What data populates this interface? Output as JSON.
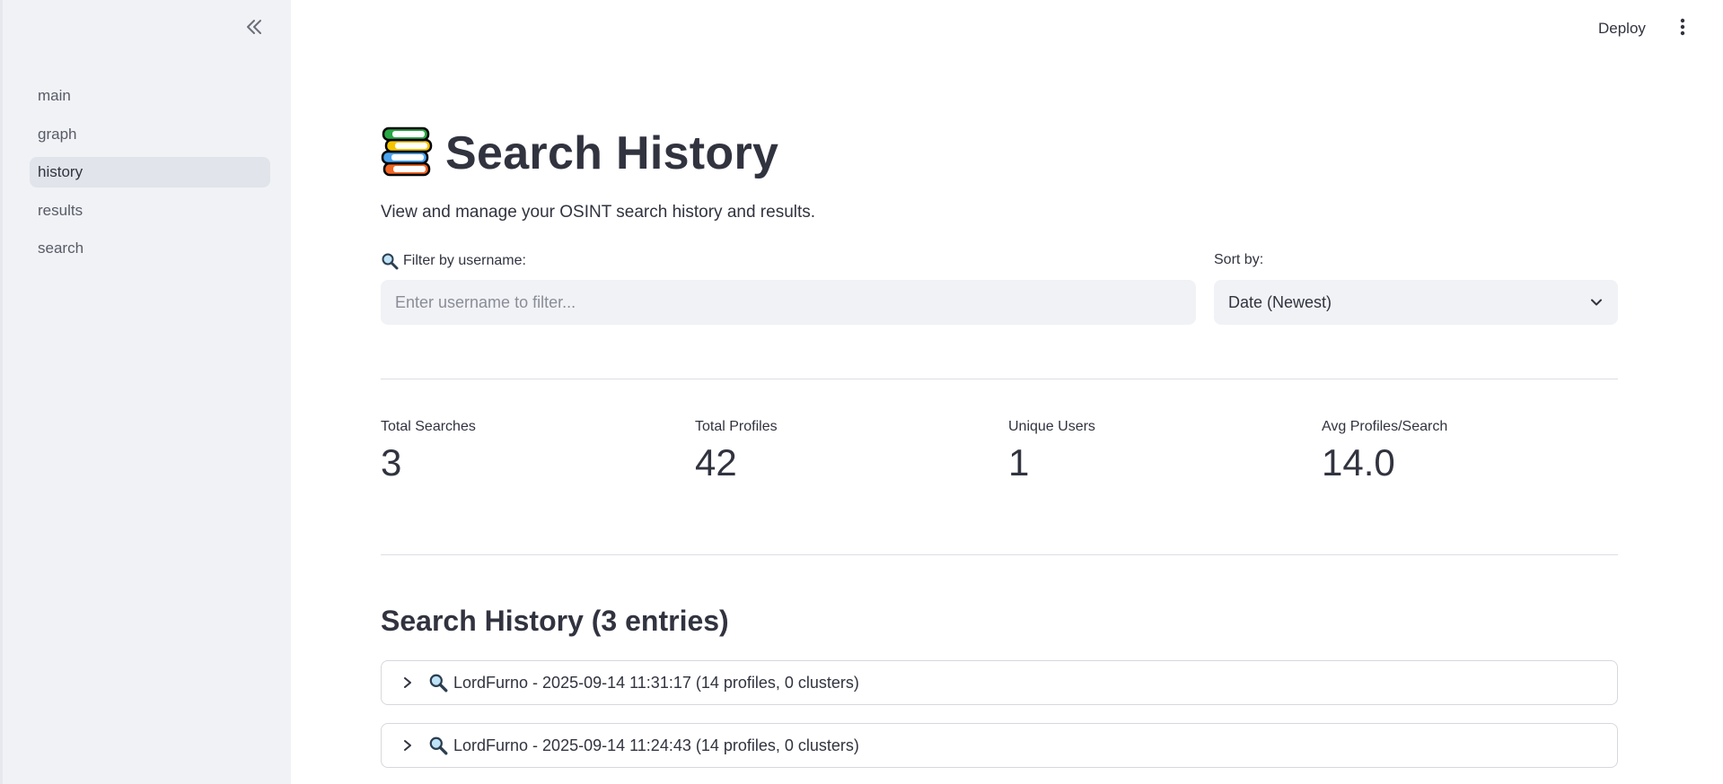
{
  "sidebar": {
    "collapse_icon": "double-chevron-left-icon",
    "items": [
      {
        "label": "main"
      },
      {
        "label": "graph"
      },
      {
        "label": "history",
        "active": true
      },
      {
        "label": "results"
      },
      {
        "label": "search"
      }
    ]
  },
  "toolbar": {
    "deploy_label": "Deploy",
    "menu_icon": "vertical-dots-icon"
  },
  "page": {
    "title_icon": "books-icon",
    "title": "Search History",
    "subtitle": "View and manage your OSINT search history and results."
  },
  "filter": {
    "icon": "magnifier-icon",
    "label": "Filter by username:",
    "placeholder": "Enter username to filter...",
    "value": ""
  },
  "sort": {
    "label": "Sort by:",
    "selected": "Date (Newest)"
  },
  "metrics": [
    {
      "label": "Total Searches",
      "value": "3"
    },
    {
      "label": "Total Profiles",
      "value": "42"
    },
    {
      "label": "Unique Users",
      "value": "1"
    },
    {
      "label": "Avg Profiles/Search",
      "value": "14.0"
    }
  ],
  "history": {
    "heading": "Search History (3 entries)",
    "entries": [
      {
        "text": "LordFurno - 2025-09-14 11:31:17 (14 profiles, 0 clusters)"
      },
      {
        "text": "LordFurno - 2025-09-14 11:24:43 (14 profiles, 0 clusters)"
      }
    ]
  },
  "colors": {
    "sidebar_bg": "#f0f2f6",
    "active_nav_bg": "#e1e4ea",
    "text": "#31333f"
  }
}
